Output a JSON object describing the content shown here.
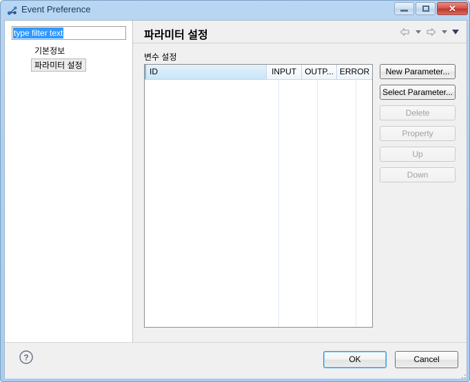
{
  "window": {
    "title": "Event Preference",
    "icon": "app-nodes-icon",
    "controls": {
      "minimize": "minimize-icon",
      "maximize": "maximize-icon",
      "close": "✕"
    }
  },
  "sidebar": {
    "filter": {
      "value": "type filter text",
      "placeholder": "type filter text",
      "selected": true
    },
    "tree_items": [
      {
        "label": "기본정보",
        "selected": false
      },
      {
        "label": "파라미터 설정",
        "selected": true
      }
    ]
  },
  "main": {
    "title": "파라미터 설정",
    "nav": {
      "back": "back-arrow-icon",
      "back_menu": "chevron-down-icon",
      "forward": "forward-arrow-icon",
      "forward_menu": "chevron-down-icon",
      "menu": "view-menu-icon"
    },
    "section_label": "변수 설정",
    "table": {
      "columns": [
        {
          "label": "ID",
          "selected": true
        },
        {
          "label": "INPUT",
          "selected": false
        },
        {
          "label": "OUTP...",
          "selected": false
        },
        {
          "label": "ERROR",
          "selected": false
        }
      ],
      "rows": []
    },
    "buttons": [
      {
        "label": "New Parameter...",
        "enabled": true
      },
      {
        "label": "Select Parameter...",
        "enabled": true
      },
      {
        "label": "Delete",
        "enabled": false
      },
      {
        "label": "Property",
        "enabled": false
      },
      {
        "label": "Up",
        "enabled": false
      },
      {
        "label": "Down",
        "enabled": false
      }
    ]
  },
  "footer": {
    "help": "help-icon",
    "ok_label": "OK",
    "cancel_label": "Cancel"
  },
  "colors": {
    "titlebar": "#aed0f0",
    "selection": "#3399ff",
    "column_selected": "#c8e6f7",
    "focus_ring": "#3c9ddb",
    "close_button": "#d75249"
  }
}
